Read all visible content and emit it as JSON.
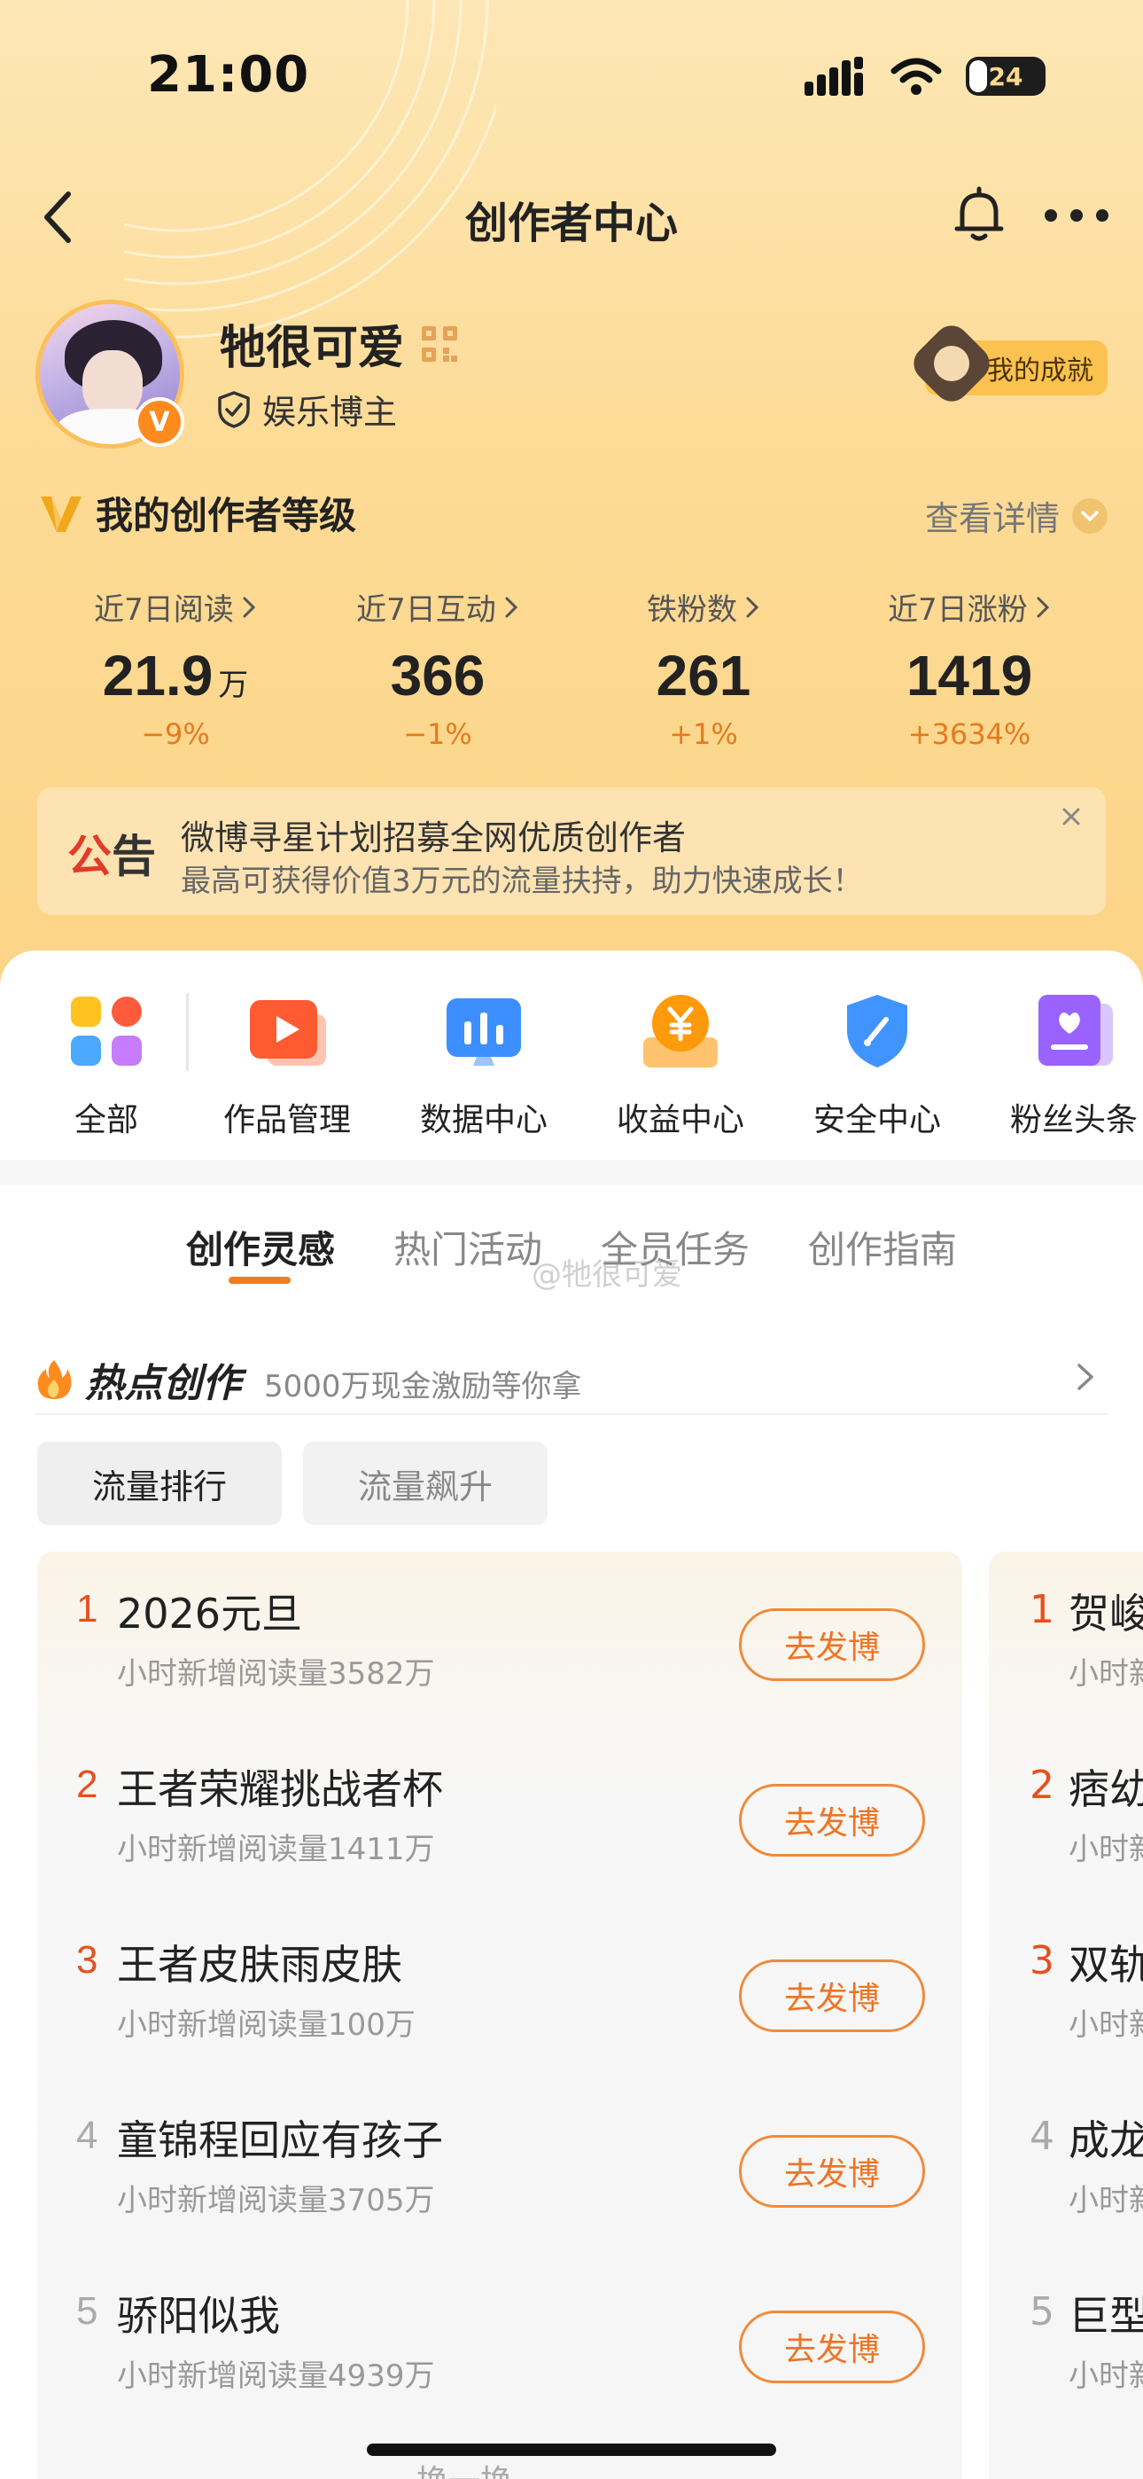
{
  "status_bar": {
    "time": "21:00",
    "battery": "24"
  },
  "nav": {
    "title": "创作者中心"
  },
  "profile": {
    "nickname": "牠很可爱",
    "role": "娱乐博主",
    "verified_badge": "V",
    "achievement_label": "我的成就"
  },
  "level": {
    "title": "我的创作者等级",
    "detail_link": "查看详情"
  },
  "stats": [
    {
      "label": "近7日阅读",
      "value": "21.9",
      "unit": "万",
      "change": "−9%"
    },
    {
      "label": "近7日互动",
      "value": "366",
      "unit": "",
      "change": "−1%"
    },
    {
      "label": "铁粉数",
      "value": "261",
      "unit": "",
      "change": "+1%"
    },
    {
      "label": "近7日涨粉",
      "value": "1419",
      "unit": "",
      "change": "+3634%"
    }
  ],
  "notice": {
    "tag_1": "公",
    "tag_2": "告",
    "line1": "微博寻星计划招募全网优质创作者",
    "line2": "最高可获得价值3万元的流量扶持，助力快速成长！"
  },
  "tools": [
    {
      "label": "全部",
      "icon": "grid-apps-icon"
    },
    {
      "label": "作品管理",
      "icon": "video-manage-icon"
    },
    {
      "label": "数据中心",
      "icon": "chart-screen-icon"
    },
    {
      "label": "收益中心",
      "icon": "yuan-coin-icon"
    },
    {
      "label": "安全中心",
      "icon": "shield-icon"
    },
    {
      "label": "粉丝头条",
      "icon": "fan-headline-icon"
    }
  ],
  "tabs": [
    "创作灵感",
    "热门活动",
    "全员任务",
    "创作指南"
  ],
  "watermark": "@牠很可爱",
  "hot": {
    "title": "热点创作",
    "subtitle": "5000万现金激励等你拿"
  },
  "chips": [
    "流量排行",
    "流量飙升"
  ],
  "ranking": [
    {
      "rank": "1",
      "title": "2026元旦",
      "sub": "小时新增阅读量3582万",
      "action": "去发博"
    },
    {
      "rank": "2",
      "title": "王者荣耀挑战者杯",
      "sub": "小时新增阅读量1411万",
      "action": "去发博"
    },
    {
      "rank": "3",
      "title": "王者皮肤雨皮肤",
      "sub": "小时新增阅读量100万",
      "action": "去发博"
    },
    {
      "rank": "4",
      "title": "童锦程回应有孩子",
      "sub": "小时新增阅读量3705万",
      "action": "去发博"
    },
    {
      "rank": "5",
      "title": "骄阳似我",
      "sub": "小时新增阅读量4939万",
      "action": "去发博"
    }
  ],
  "ranking2": [
    {
      "rank": "1",
      "title": "贺峻",
      "sub": "小时新"
    },
    {
      "rank": "2",
      "title": "痞幼",
      "sub": "小时新"
    },
    {
      "rank": "3",
      "title": "双轨",
      "sub": "小时新"
    },
    {
      "rank": "4",
      "title": "成龙",
      "sub": "小时新"
    },
    {
      "rank": "5",
      "title": "巨型",
      "sub": "小时新"
    }
  ],
  "refresh_label": "换一换",
  "colors": {
    "accent": "#f07d1e",
    "hero_top": "#fde7b6",
    "hero_bottom": "#fcd486",
    "rank_top": "#e84f1e"
  }
}
